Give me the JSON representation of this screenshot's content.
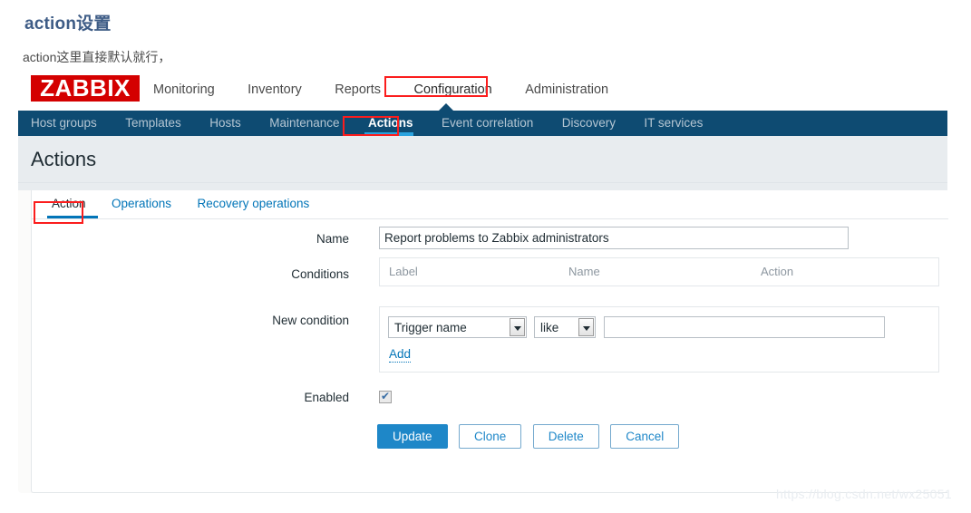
{
  "blog": {
    "heading": "action设置",
    "description": "action这里直接默认就行，",
    "watermark": "https://blog.csdn.net/wx25051"
  },
  "app": {
    "logo": "ZABBIX",
    "top_menu": [
      {
        "label": "Monitoring",
        "active": false
      },
      {
        "label": "Inventory",
        "active": false
      },
      {
        "label": "Reports",
        "active": false
      },
      {
        "label": "Configuration",
        "active": true
      },
      {
        "label": "Administration",
        "active": false
      }
    ],
    "nav_menu": [
      {
        "label": "Host groups",
        "active": false
      },
      {
        "label": "Templates",
        "active": false
      },
      {
        "label": "Hosts",
        "active": false
      },
      {
        "label": "Maintenance",
        "active": false
      },
      {
        "label": "Actions",
        "active": true
      },
      {
        "label": "Event correlation",
        "active": false
      },
      {
        "label": "Discovery",
        "active": false
      },
      {
        "label": "IT services",
        "active": false
      }
    ],
    "page_title": "Actions"
  },
  "tabs": [
    {
      "label": "Action",
      "active": true
    },
    {
      "label": "Operations",
      "active": false
    },
    {
      "label": "Recovery operations",
      "active": false
    }
  ],
  "form": {
    "name": {
      "label": "Name",
      "value": "Report problems to Zabbix administrators"
    },
    "conditions": {
      "label": "Conditions",
      "columns": [
        "Label",
        "Name",
        "Action"
      ],
      "rows": []
    },
    "new_condition": {
      "label": "New condition",
      "type_value": "Trigger name",
      "operator_value": "like",
      "value": "",
      "add_label": "Add"
    },
    "enabled": {
      "label": "Enabled",
      "checked": true
    },
    "buttons": [
      {
        "label": "Update",
        "style": "primary"
      },
      {
        "label": "Clone",
        "style": "secondary"
      },
      {
        "label": "Delete",
        "style": "secondary"
      },
      {
        "label": "Cancel",
        "style": "secondary"
      }
    ]
  },
  "annotations": {
    "color": "#fb1d1d",
    "targets": [
      "Configuration",
      "Actions",
      "Action"
    ]
  },
  "colors": {
    "logo_red": "#d40000",
    "navbar_navy": "#0e4b72",
    "accent_blue": "#0275b8",
    "primary_button": "#1e87c8",
    "subheader_grey": "#e8ecef"
  }
}
